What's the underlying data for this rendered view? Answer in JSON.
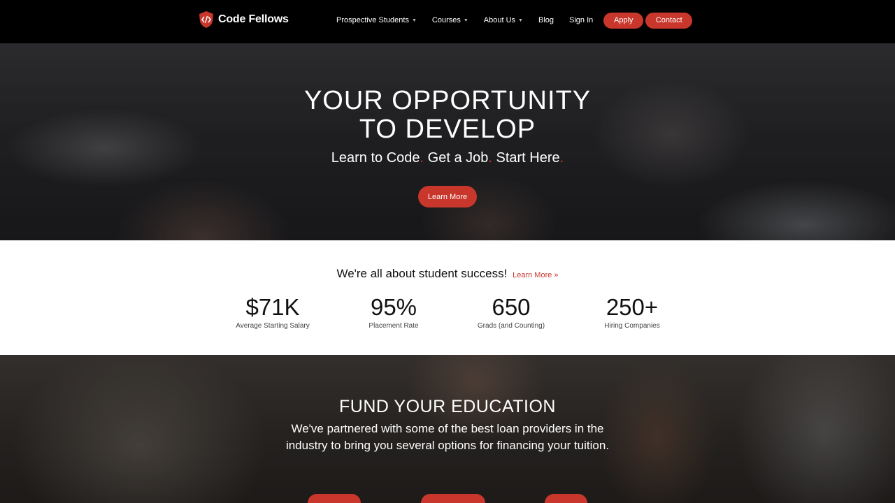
{
  "nav": {
    "logo_text": "Code Fellows",
    "logo_icon": "code-shield-icon",
    "links": [
      {
        "label": "Prospective Students",
        "has_dropdown": true
      },
      {
        "label": "Courses",
        "has_dropdown": true
      },
      {
        "label": "About Us",
        "has_dropdown": true
      },
      {
        "label": "Blog",
        "has_dropdown": false
      },
      {
        "label": "Sign In",
        "has_dropdown": false
      }
    ],
    "apply_label": "Apply",
    "contact_label": "Contact"
  },
  "hero": {
    "title_line1": "YOUR OPPORTUNITY",
    "title_line2": "TO DEVELOP",
    "subtitle_parts": [
      "Learn to Code",
      "Get a Job",
      "Start Here"
    ],
    "subtitle_separator": ".",
    "button_label": "Learn More"
  },
  "stats": {
    "headline": "We're all about student success!",
    "link_label": "Learn More »",
    "items": [
      {
        "value": "$71K",
        "label": "Average Starting Salary"
      },
      {
        "value": "95%",
        "label": "Placement Rate"
      },
      {
        "value": "650",
        "label": "Grads (and Counting)"
      },
      {
        "value": "250+",
        "label": "Hiring Companies"
      }
    ]
  },
  "fund": {
    "title": "FUND YOUR EDUCATION",
    "text": "We've partnered with some of the best loan providers in the industry to bring you several options for financing your tuition."
  },
  "colors": {
    "accent": "#c9372c",
    "nav_bg": "#000000",
    "stats_bg": "#ffffff"
  }
}
